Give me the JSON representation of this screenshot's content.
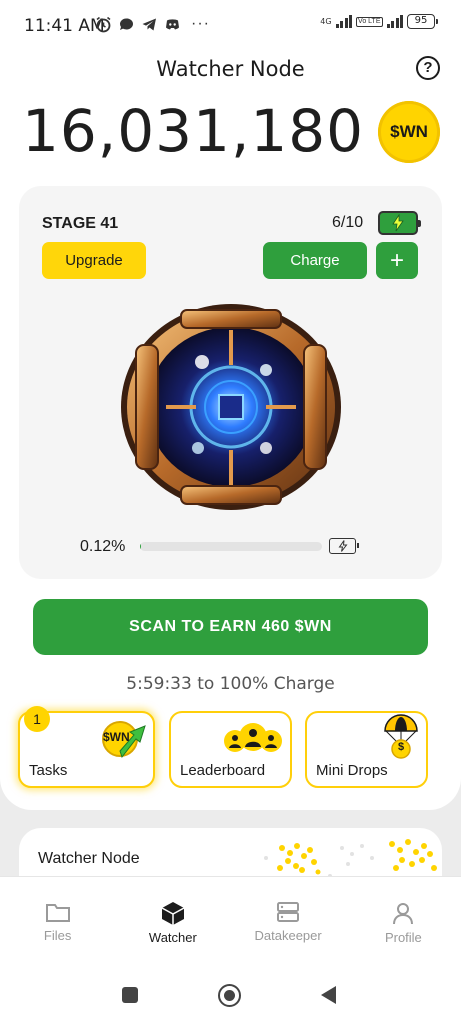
{
  "status_bar": {
    "time": "11:41 AM",
    "left_icons": [
      "alarm-icon",
      "chat-bubble-icon",
      "telegram-icon",
      "discord-icon"
    ],
    "more_dots": "···",
    "network_label": "4G",
    "volte_label": "Vo LTE",
    "battery_level": "95"
  },
  "header": {
    "title": "Watcher Node",
    "help_symbol": "?"
  },
  "balance": {
    "amount": "16,031,180",
    "coin_label": "$WN"
  },
  "stage": {
    "label": "STAGE 41",
    "charges": "6/10",
    "upgrade_label": "Upgrade",
    "charge_label": "Charge",
    "plus_label": "+",
    "progress_text": "0.12%",
    "progress_fraction": 0.0012
  },
  "scan": {
    "button_label": "SCAN TO EARN 460 $WN",
    "charge_time": "5:59:33 to 100% Charge"
  },
  "features": {
    "tasks_label": "Tasks",
    "tasks_badge": "1",
    "tasks_coin": "$WN",
    "leaderboard_label": "Leaderboard",
    "mini_drops_label": "Mini Drops",
    "mini_drops_coin": "$"
  },
  "lower_card": {
    "title": "Watcher Node"
  },
  "bottom_nav": {
    "items": [
      {
        "label": "Files",
        "icon": "folder-icon"
      },
      {
        "label": "Watcher",
        "icon": "cube-icon"
      },
      {
        "label": "Datakeeper",
        "icon": "server-icon"
      },
      {
        "label": "Profile",
        "icon": "person-icon"
      }
    ],
    "active": "Watcher"
  },
  "colors": {
    "accent_green": "#2f9f3d",
    "accent_yellow": "#ffd60a",
    "text_dark": "#1d1d1d"
  }
}
